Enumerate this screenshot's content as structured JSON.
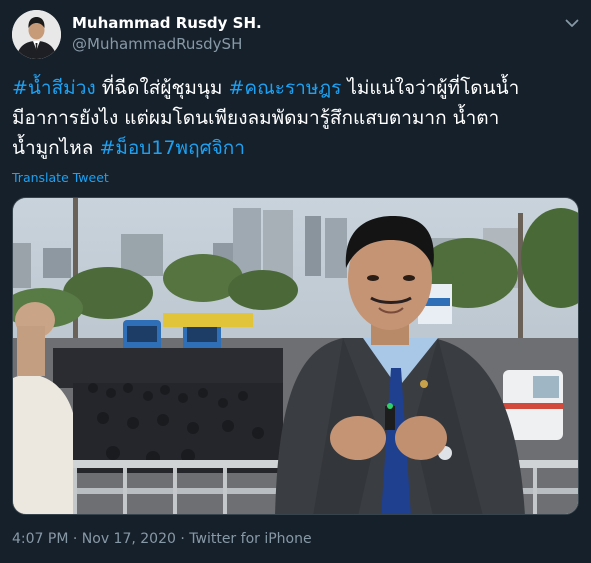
{
  "user": {
    "display_name": "Muhammad Rusdy SH.",
    "handle": "@MuhammadRusdySH"
  },
  "tweet": {
    "line1": {
      "tag1": "#น้ำสีม่วง",
      "text1": " ที่ฉีดใส่ผู้ชุมนุม ",
      "tag2": "#คณะราษฎร",
      "text2": " ไม่แน่ใจว่าผู้ที่โดนน้ำ"
    },
    "line2": "มีอาการยังไง แต่ผมโดนเพียงลมพัดมารู้สึกแสบตามาก น้ำตา",
    "line3": {
      "text": "น้ำมูกไหล ",
      "tag": "#ม็อบ17พฤศจิกา"
    },
    "translate_label": "Translate Tweet"
  },
  "media": {
    "description_icon": "video-still"
  },
  "meta": {
    "time": "4:07 PM",
    "sep1": " · ",
    "date": "Nov 17, 2020",
    "sep2": " · ",
    "source": "Twitter for iPhone"
  },
  "colors": {
    "background": "#15202b",
    "link": "#1da1f2",
    "secondary_text": "#8899a6"
  }
}
